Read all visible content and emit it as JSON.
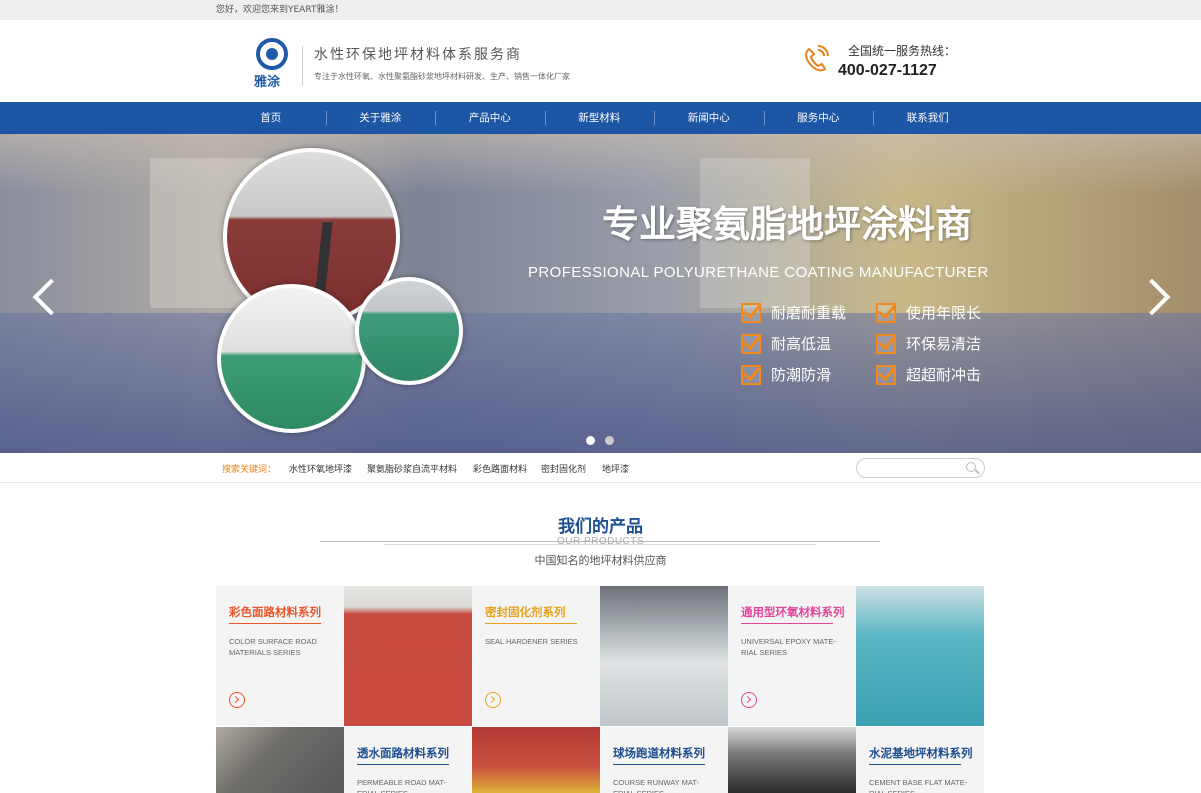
{
  "topbar": {
    "welcome": "您好，欢迎您来到YEART雅涂！"
  },
  "header": {
    "logo_text": "雅涂",
    "slogan": "水性环保地坪材料体系服务商",
    "sub": "专注于水性环氧、水性聚氨酯砂浆地坪材料研发、生产、销售一体化厂家",
    "hotline_label": "全国统一服务热线：",
    "hotline": "400-027-1127"
  },
  "nav": {
    "items": [
      "首页",
      "关于雅涂",
      "产品中心",
      "新型材料",
      "新闻中心",
      "服务中心",
      "联系我们"
    ]
  },
  "banner": {
    "title": "专业聚氨脂地坪涂料商",
    "subtitle": "PROFESSIONAL POLYURETHANE COATING MANUFACTURER",
    "features": [
      "耐磨耐重载",
      "使用年限长",
      "耐高低温",
      "环保易清洁",
      "防潮防滑",
      "超超耐冲击"
    ]
  },
  "keywords": {
    "label": "搜索关键词：",
    "items": [
      "水性环氧地坪漆",
      "聚氨脂砂浆自流平材料",
      "彩色路面材料",
      "密封固化剂",
      "地坪漆"
    ]
  },
  "products": {
    "title": "我们的产品",
    "title_en": "OUR PRODUCTS",
    "subtitle": "中国知名的地坪材料供应商",
    "items": [
      {
        "name": "彩色面路材料系列",
        "en": "COLOR SURFACE ROAD MATERIALS SERIES",
        "color": "#e8572a"
      },
      {
        "name": "密封固化剂系列",
        "en": "SEAL HARDENER SERIES",
        "color": "#e8a21c"
      },
      {
        "name": "通用型环氧材料系列",
        "en": "UNIVERSAL EPOXY MATE-RIAL SERIES",
        "color": "#e0479a"
      },
      {
        "name": "透水面路材料系列",
        "en": "PERMEABLE ROAD MAT-ERIAL SERIES",
        "color": "#1d4f8f"
      },
      {
        "name": "球场跑道材料系列",
        "en": "COURSE RUNWAY MAT-ERIAL SERIES",
        "color": "#1d4f8f"
      },
      {
        "name": "水泥基地坪材料系列",
        "en": "CEMENT BASE FLAT MATE-RIAL SERIES",
        "color": "#1d4f8f"
      }
    ]
  }
}
